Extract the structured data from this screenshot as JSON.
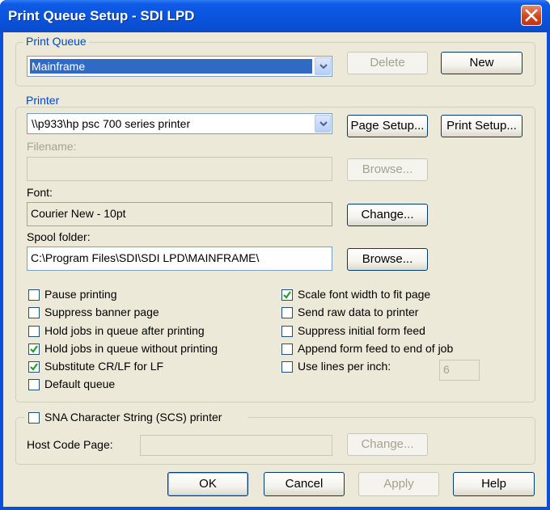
{
  "window": {
    "title": "Print Queue Setup - SDI LPD"
  },
  "print_queue": {
    "legend": "Print Queue",
    "selected": "Mainframe",
    "delete_label": "Delete",
    "new_label": "New"
  },
  "printer": {
    "legend": "Printer",
    "selected": "\\\\p933\\hp psc 700 series printer",
    "page_setup_label": "Page Setup...",
    "print_setup_label": "Print Setup...",
    "filename_label": "Filename:",
    "filename_value": "",
    "browse_filename_label": "Browse...",
    "font_label": "Font:",
    "font_value": "Courier New - 10pt",
    "change_font_label": "Change...",
    "spool_label": "Spool folder:",
    "spool_value": "C:\\Program Files\\SDI\\SDI LPD\\MAINFRAME\\",
    "browse_spool_label": "Browse..."
  },
  "options_left": [
    {
      "label": "Pause printing",
      "checked": false
    },
    {
      "label": "Suppress banner page",
      "checked": false
    },
    {
      "label": "Hold jobs in queue after printing",
      "checked": false
    },
    {
      "label": "Hold jobs in queue without printing",
      "checked": true
    },
    {
      "label": "Substitute CR/LF for LF",
      "checked": true
    },
    {
      "label": "Default queue",
      "checked": false
    }
  ],
  "options_right": [
    {
      "label": "Scale font width to fit page",
      "checked": true
    },
    {
      "label": "Send raw data to printer",
      "checked": false
    },
    {
      "label": "Suppress initial form feed",
      "checked": false
    },
    {
      "label": "Append form feed to end of job",
      "checked": false
    },
    {
      "label": "Use lines per inch:",
      "checked": false
    }
  ],
  "lines_per_inch_value": "6",
  "sna": {
    "checkbox_label": "SNA Character String (SCS) printer",
    "checked": false,
    "host_code_page_label": "Host Code Page:",
    "host_code_page_value": "",
    "change_label": "Change..."
  },
  "footer": {
    "ok_label": "OK",
    "cancel_label": "Cancel",
    "apply_label": "Apply",
    "help_label": "Help"
  },
  "colors": {
    "titlebar": "#0a53dc",
    "dialog_bg": "#ece9d8",
    "legend_text": "#0046d5",
    "close_button": "#d0451f",
    "checkmark": "#21a121"
  }
}
